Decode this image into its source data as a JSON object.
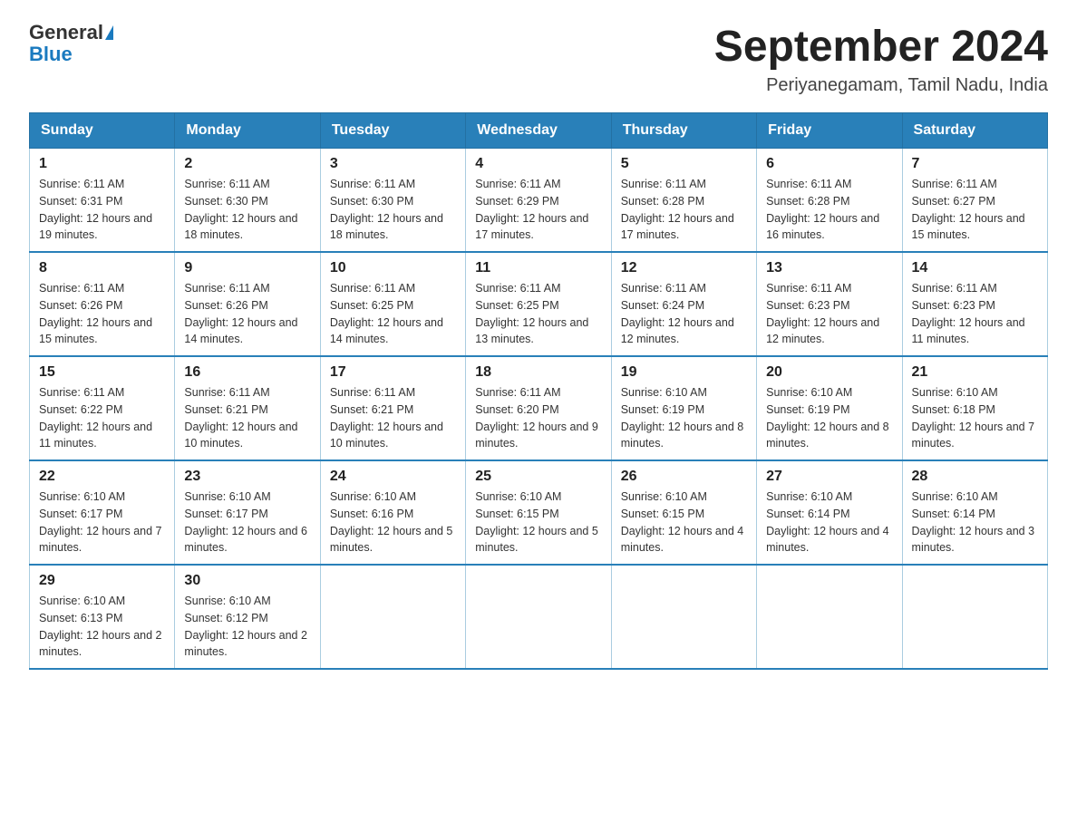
{
  "header": {
    "logo_general": "General",
    "logo_blue": "Blue",
    "title": "September 2024",
    "subtitle": "Periyanegamam, Tamil Nadu, India"
  },
  "columns": [
    "Sunday",
    "Monday",
    "Tuesday",
    "Wednesday",
    "Thursday",
    "Friday",
    "Saturday"
  ],
  "weeks": [
    [
      {
        "day": "1",
        "sunrise": "Sunrise: 6:11 AM",
        "sunset": "Sunset: 6:31 PM",
        "daylight": "Daylight: 12 hours and 19 minutes."
      },
      {
        "day": "2",
        "sunrise": "Sunrise: 6:11 AM",
        "sunset": "Sunset: 6:30 PM",
        "daylight": "Daylight: 12 hours and 18 minutes."
      },
      {
        "day": "3",
        "sunrise": "Sunrise: 6:11 AM",
        "sunset": "Sunset: 6:30 PM",
        "daylight": "Daylight: 12 hours and 18 minutes."
      },
      {
        "day": "4",
        "sunrise": "Sunrise: 6:11 AM",
        "sunset": "Sunset: 6:29 PM",
        "daylight": "Daylight: 12 hours and 17 minutes."
      },
      {
        "day": "5",
        "sunrise": "Sunrise: 6:11 AM",
        "sunset": "Sunset: 6:28 PM",
        "daylight": "Daylight: 12 hours and 17 minutes."
      },
      {
        "day": "6",
        "sunrise": "Sunrise: 6:11 AM",
        "sunset": "Sunset: 6:28 PM",
        "daylight": "Daylight: 12 hours and 16 minutes."
      },
      {
        "day": "7",
        "sunrise": "Sunrise: 6:11 AM",
        "sunset": "Sunset: 6:27 PM",
        "daylight": "Daylight: 12 hours and 15 minutes."
      }
    ],
    [
      {
        "day": "8",
        "sunrise": "Sunrise: 6:11 AM",
        "sunset": "Sunset: 6:26 PM",
        "daylight": "Daylight: 12 hours and 15 minutes."
      },
      {
        "day": "9",
        "sunrise": "Sunrise: 6:11 AM",
        "sunset": "Sunset: 6:26 PM",
        "daylight": "Daylight: 12 hours and 14 minutes."
      },
      {
        "day": "10",
        "sunrise": "Sunrise: 6:11 AM",
        "sunset": "Sunset: 6:25 PM",
        "daylight": "Daylight: 12 hours and 14 minutes."
      },
      {
        "day": "11",
        "sunrise": "Sunrise: 6:11 AM",
        "sunset": "Sunset: 6:25 PM",
        "daylight": "Daylight: 12 hours and 13 minutes."
      },
      {
        "day": "12",
        "sunrise": "Sunrise: 6:11 AM",
        "sunset": "Sunset: 6:24 PM",
        "daylight": "Daylight: 12 hours and 12 minutes."
      },
      {
        "day": "13",
        "sunrise": "Sunrise: 6:11 AM",
        "sunset": "Sunset: 6:23 PM",
        "daylight": "Daylight: 12 hours and 12 minutes."
      },
      {
        "day": "14",
        "sunrise": "Sunrise: 6:11 AM",
        "sunset": "Sunset: 6:23 PM",
        "daylight": "Daylight: 12 hours and 11 minutes."
      }
    ],
    [
      {
        "day": "15",
        "sunrise": "Sunrise: 6:11 AM",
        "sunset": "Sunset: 6:22 PM",
        "daylight": "Daylight: 12 hours and 11 minutes."
      },
      {
        "day": "16",
        "sunrise": "Sunrise: 6:11 AM",
        "sunset": "Sunset: 6:21 PM",
        "daylight": "Daylight: 12 hours and 10 minutes."
      },
      {
        "day": "17",
        "sunrise": "Sunrise: 6:11 AM",
        "sunset": "Sunset: 6:21 PM",
        "daylight": "Daylight: 12 hours and 10 minutes."
      },
      {
        "day": "18",
        "sunrise": "Sunrise: 6:11 AM",
        "sunset": "Sunset: 6:20 PM",
        "daylight": "Daylight: 12 hours and 9 minutes."
      },
      {
        "day": "19",
        "sunrise": "Sunrise: 6:10 AM",
        "sunset": "Sunset: 6:19 PM",
        "daylight": "Daylight: 12 hours and 8 minutes."
      },
      {
        "day": "20",
        "sunrise": "Sunrise: 6:10 AM",
        "sunset": "Sunset: 6:19 PM",
        "daylight": "Daylight: 12 hours and 8 minutes."
      },
      {
        "day": "21",
        "sunrise": "Sunrise: 6:10 AM",
        "sunset": "Sunset: 6:18 PM",
        "daylight": "Daylight: 12 hours and 7 minutes."
      }
    ],
    [
      {
        "day": "22",
        "sunrise": "Sunrise: 6:10 AM",
        "sunset": "Sunset: 6:17 PM",
        "daylight": "Daylight: 12 hours and 7 minutes."
      },
      {
        "day": "23",
        "sunrise": "Sunrise: 6:10 AM",
        "sunset": "Sunset: 6:17 PM",
        "daylight": "Daylight: 12 hours and 6 minutes."
      },
      {
        "day": "24",
        "sunrise": "Sunrise: 6:10 AM",
        "sunset": "Sunset: 6:16 PM",
        "daylight": "Daylight: 12 hours and 5 minutes."
      },
      {
        "day": "25",
        "sunrise": "Sunrise: 6:10 AM",
        "sunset": "Sunset: 6:15 PM",
        "daylight": "Daylight: 12 hours and 5 minutes."
      },
      {
        "day": "26",
        "sunrise": "Sunrise: 6:10 AM",
        "sunset": "Sunset: 6:15 PM",
        "daylight": "Daylight: 12 hours and 4 minutes."
      },
      {
        "day": "27",
        "sunrise": "Sunrise: 6:10 AM",
        "sunset": "Sunset: 6:14 PM",
        "daylight": "Daylight: 12 hours and 4 minutes."
      },
      {
        "day": "28",
        "sunrise": "Sunrise: 6:10 AM",
        "sunset": "Sunset: 6:14 PM",
        "daylight": "Daylight: 12 hours and 3 minutes."
      }
    ],
    [
      {
        "day": "29",
        "sunrise": "Sunrise: 6:10 AM",
        "sunset": "Sunset: 6:13 PM",
        "daylight": "Daylight: 12 hours and 2 minutes."
      },
      {
        "day": "30",
        "sunrise": "Sunrise: 6:10 AM",
        "sunset": "Sunset: 6:12 PM",
        "daylight": "Daylight: 12 hours and 2 minutes."
      },
      null,
      null,
      null,
      null,
      null
    ]
  ]
}
